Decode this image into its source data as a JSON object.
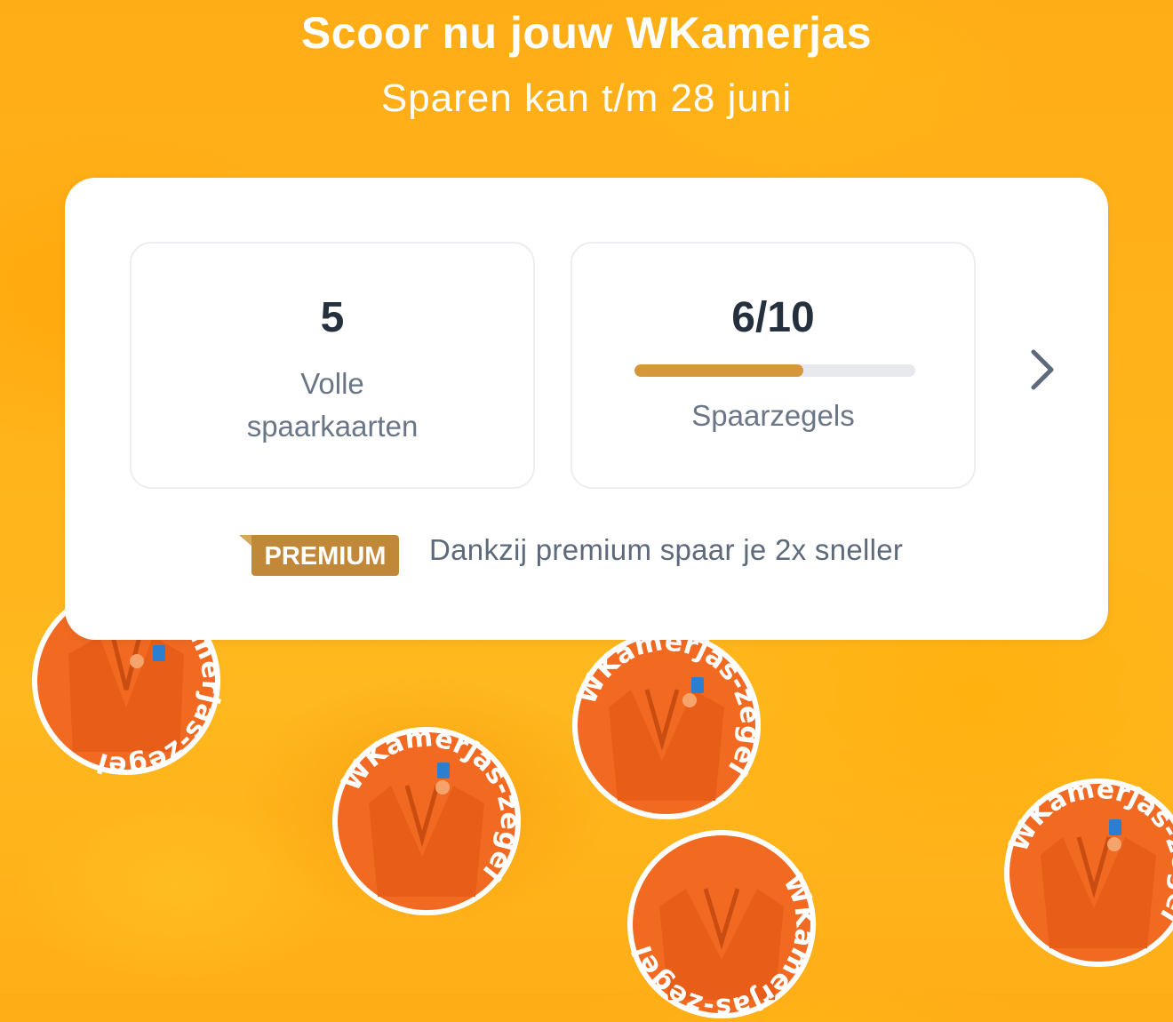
{
  "hero": {
    "title": "Scoor nu jouw WKamerjas",
    "subtitle": "Sparen kan t/m 28 juni"
  },
  "stats": {
    "cards": {
      "value": "5",
      "label_line1": "Volle",
      "label_line2": "spaarkaarten"
    },
    "stamps": {
      "value": "6/10",
      "progress": 0.6,
      "label": "Spaarzegels"
    }
  },
  "premium": {
    "badge": "PREMIUM",
    "text": "Dankzij premium spaar je 2x sneller"
  },
  "stamp_text": "WKamerjas-zegel",
  "colors": {
    "background": "#ffb31a",
    "progress": "#d6973a",
    "badge": "#c2883a",
    "robe": "#f26a21"
  }
}
